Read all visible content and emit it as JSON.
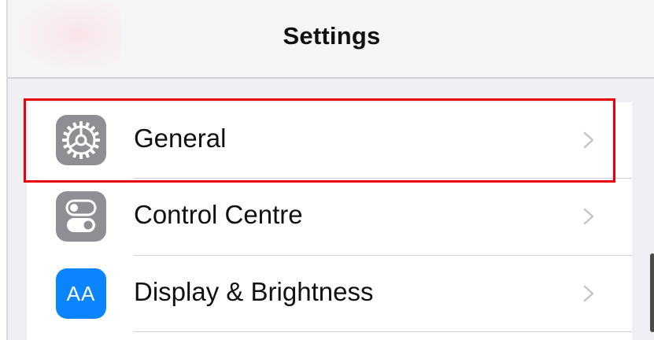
{
  "navbar": {
    "title": "Settings"
  },
  "settings_list": {
    "items": [
      {
        "label": "General",
        "icon": "gear-icon",
        "icon_color": "#8e8e93",
        "selected": true
      },
      {
        "label": "Control Centre",
        "icon": "toggles-icon",
        "icon_color": "#8e8e93",
        "selected": false
      },
      {
        "label": "Display & Brightness",
        "icon": "aa-text-icon",
        "icon_text": "AA",
        "icon_color": "#0a84ff",
        "selected": false
      }
    ]
  },
  "colors": {
    "highlight": "#e8000b",
    "system_gray": "#8e8e93",
    "system_blue": "#0a84ff"
  }
}
